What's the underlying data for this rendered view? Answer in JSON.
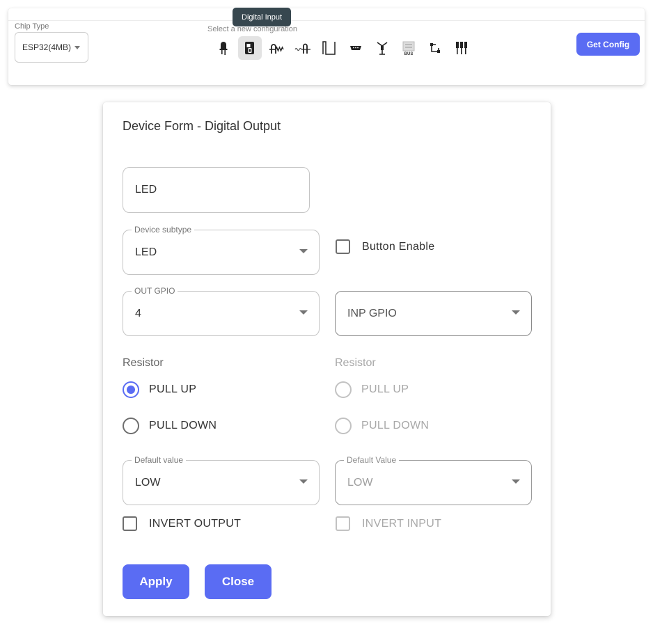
{
  "topbar": {
    "chip_type_label": "Chip Type",
    "chip_type_value": "ESP32(4MB)",
    "config_label": "Select a new configuration",
    "tooltip": "Digital Input",
    "get_config_label": "Get Config",
    "config_icons": [
      {
        "name": "led-icon",
        "selected": false
      },
      {
        "name": "digital-input-icon",
        "selected": true
      },
      {
        "name": "resistor-icon",
        "selected": false
      },
      {
        "name": "sensor-wave-icon",
        "selected": false
      },
      {
        "name": "square-wave-icon",
        "selected": false
      },
      {
        "name": "connector-icon",
        "selected": false
      },
      {
        "name": "antenna-icon",
        "selected": false
      },
      {
        "name": "bus-icon",
        "selected": false,
        "text": "BUS"
      },
      {
        "name": "circuit-icon",
        "selected": false
      },
      {
        "name": "pins-icon",
        "selected": false
      }
    ]
  },
  "dialog": {
    "title": "Device Form - Digital Output",
    "name_value": "LED",
    "subtype": {
      "label": "Device subtype",
      "value": "LED"
    },
    "button_enable_label": "Button Enable",
    "out_gpio": {
      "label": "OUT GPIO",
      "value": "4"
    },
    "inp_gpio": {
      "placeholder": "INP GPIO"
    },
    "left_resistor": {
      "label": "Resistor",
      "pull_up": "PULL UP",
      "pull_down": "PULL DOWN",
      "selected": "PULL UP"
    },
    "right_resistor": {
      "label": "Resistor",
      "pull_up": "PULL UP",
      "pull_down": "PULL DOWN"
    },
    "default_value": {
      "label": "Default value",
      "value": "LOW"
    },
    "default_value_input": {
      "label": "Default Value",
      "value": "LOW"
    },
    "invert_output_label": "INVERT OUTPUT",
    "invert_input_label": "INVERT INPUT",
    "apply_label": "Apply",
    "close_label": "Close"
  },
  "colors": {
    "accent": "#5a6cf3",
    "tooltip_bg": "#37474f"
  }
}
